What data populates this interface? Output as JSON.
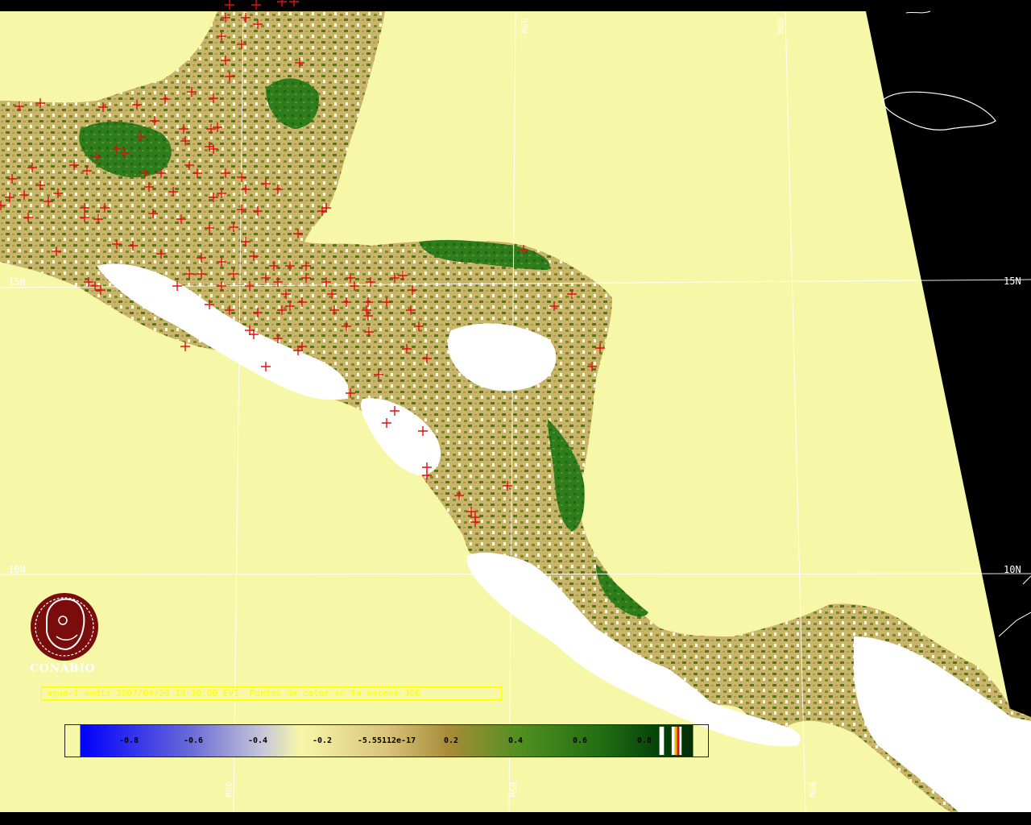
{
  "map": {
    "caption": "aqua-1 modis 2007/04/20 19:10:00 EVI. Puntos de calor en la escena 308",
    "logo_text": "CONABIO",
    "lat_labels": [
      "15N",
      "10N"
    ],
    "lon_labels": [
      "90W",
      "85W",
      "80W"
    ],
    "colors": {
      "ocean": "#f7f7a8",
      "land_dry": "#ffffff",
      "vegetation_light": "#b8a050",
      "vegetation_dense": "#2a7a18",
      "hotspot": "#e01010",
      "outside_scene": "#000000",
      "graticule": "#ffffff"
    },
    "colorbar": {
      "ticks": [
        "-0.8",
        "-0.6",
        "-0.4",
        "-0.2",
        "-5.55112e-17",
        "0.2",
        "0.4",
        "0.6",
        "0.8"
      ]
    },
    "icons": [
      "conabio-logo-icon",
      "hotspot-marker-icon"
    ]
  }
}
